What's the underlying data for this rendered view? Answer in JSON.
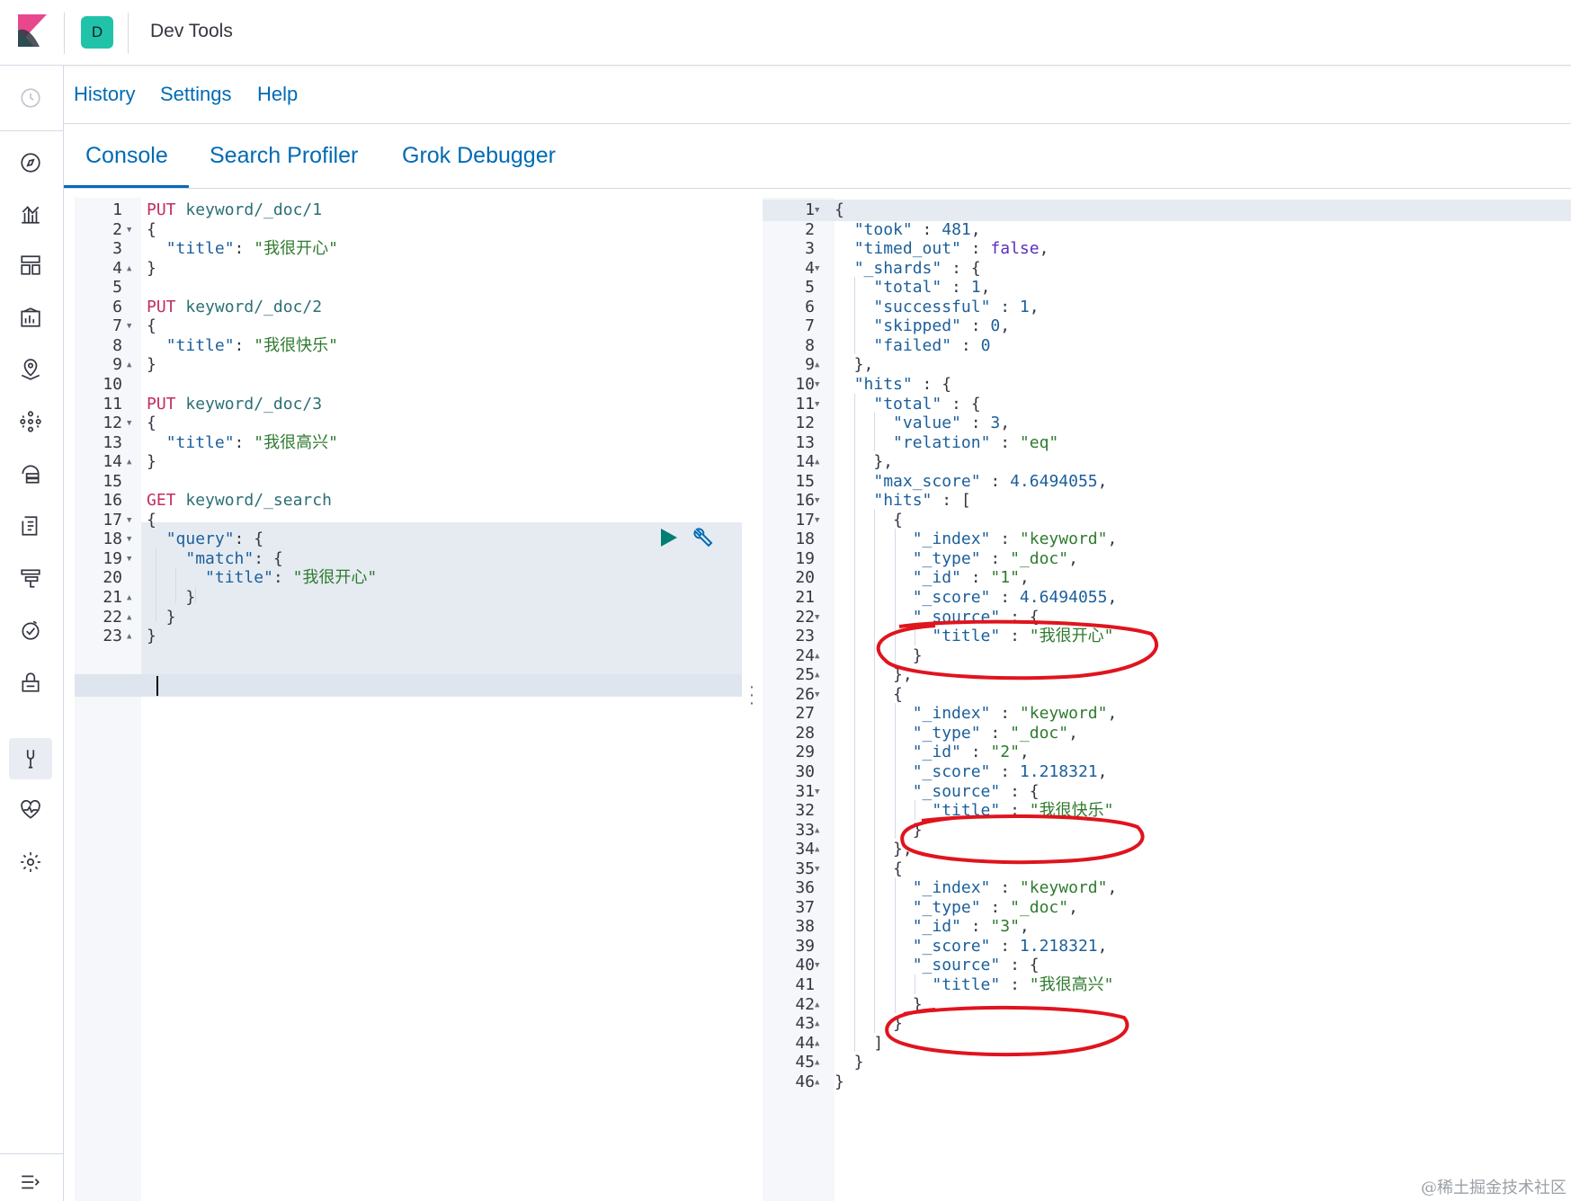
{
  "header": {
    "space_initial": "D",
    "app_title": "Dev Tools"
  },
  "topmenu": {
    "history": "History",
    "settings": "Settings",
    "help": "Help"
  },
  "tabs": [
    {
      "label": "Console"
    },
    {
      "label": "Search Profiler"
    },
    {
      "label": "Grok Debugger"
    }
  ],
  "sidenav_icons": [
    "recently-viewed-icon",
    "discover-icon",
    "visualize-icon",
    "dashboard-icon",
    "canvas-icon",
    "maps-icon",
    "machine-learning-icon",
    "infrastructure-icon",
    "logs-icon",
    "apm-icon",
    "uptime-icon",
    "siem-icon",
    "dev-tools-icon",
    "monitoring-icon",
    "management-icon",
    "collapse-menu-icon"
  ],
  "request_editor": {
    "lines": [
      [
        [
          "m",
          "PUT"
        ],
        [
          "p",
          " "
        ],
        [
          "u",
          "keyword/_doc/1"
        ]
      ],
      [
        [
          "p",
          "{"
        ]
      ],
      [
        [
          "p",
          "  "
        ],
        [
          "k",
          "\"title\""
        ],
        [
          "p",
          ": "
        ],
        [
          "s",
          "\"我很开心\""
        ]
      ],
      [
        [
          "p",
          "}"
        ]
      ],
      [],
      [
        [
          "m",
          "PUT"
        ],
        [
          "p",
          " "
        ],
        [
          "u",
          "keyword/_doc/2"
        ]
      ],
      [
        [
          "p",
          "{"
        ]
      ],
      [
        [
          "p",
          "  "
        ],
        [
          "k",
          "\"title\""
        ],
        [
          "p",
          ": "
        ],
        [
          "s",
          "\"我很快乐\""
        ]
      ],
      [
        [
          "p",
          "}"
        ]
      ],
      [],
      [
        [
          "m",
          "PUT"
        ],
        [
          "p",
          " "
        ],
        [
          "u",
          "keyword/_doc/3"
        ]
      ],
      [
        [
          "p",
          "{"
        ]
      ],
      [
        [
          "p",
          "  "
        ],
        [
          "k",
          "\"title\""
        ],
        [
          "p",
          ": "
        ],
        [
          "s",
          "\"我很高兴\""
        ]
      ],
      [
        [
          "p",
          "}"
        ]
      ],
      [],
      [
        [
          "m",
          "GET"
        ],
        [
          "p",
          " "
        ],
        [
          "u",
          "keyword/_search"
        ]
      ],
      [
        [
          "p",
          "{"
        ]
      ],
      [
        [
          "p",
          "  "
        ],
        [
          "k",
          "\"query\""
        ],
        [
          "p",
          ": {"
        ]
      ],
      [
        [
          "p",
          "    "
        ],
        [
          "k",
          "\"match\""
        ],
        [
          "p",
          ": {"
        ]
      ],
      [
        [
          "p",
          "      "
        ],
        [
          "k",
          "\"title\""
        ],
        [
          "p",
          ": "
        ],
        [
          "s",
          "\"我很开心\""
        ]
      ],
      [
        [
          "p",
          "    }"
        ]
      ],
      [
        [
          "p",
          "  }"
        ]
      ],
      [
        [
          "p",
          "}"
        ]
      ]
    ],
    "fold_markers": {
      "2": "down",
      "4": "up",
      "7": "down",
      "9": "up",
      "12": "down",
      "14": "up",
      "17": "down",
      "18": "down",
      "19": "down",
      "21": "up",
      "22": "up",
      "23": "up"
    }
  },
  "response_output": {
    "lines": [
      [
        [
          "p",
          "{"
        ]
      ],
      [
        [
          "p",
          "  "
        ],
        [
          "k",
          "\"took\""
        ],
        [
          "p",
          " : "
        ],
        [
          "n",
          "481"
        ],
        [
          "p",
          ","
        ]
      ],
      [
        [
          "p",
          "  "
        ],
        [
          "k",
          "\"timed_out\""
        ],
        [
          "p",
          " : "
        ],
        [
          "b",
          "false"
        ],
        [
          "p",
          ","
        ]
      ],
      [
        [
          "p",
          "  "
        ],
        [
          "k",
          "\"_shards\""
        ],
        [
          "p",
          " : {"
        ]
      ],
      [
        [
          "p",
          "    "
        ],
        [
          "k",
          "\"total\""
        ],
        [
          "p",
          " : "
        ],
        [
          "n",
          "1"
        ],
        [
          "p",
          ","
        ]
      ],
      [
        [
          "p",
          "    "
        ],
        [
          "k",
          "\"successful\""
        ],
        [
          "p",
          " : "
        ],
        [
          "n",
          "1"
        ],
        [
          "p",
          ","
        ]
      ],
      [
        [
          "p",
          "    "
        ],
        [
          "k",
          "\"skipped\""
        ],
        [
          "p",
          " : "
        ],
        [
          "n",
          "0"
        ],
        [
          "p",
          ","
        ]
      ],
      [
        [
          "p",
          "    "
        ],
        [
          "k",
          "\"failed\""
        ],
        [
          "p",
          " : "
        ],
        [
          "n",
          "0"
        ]
      ],
      [
        [
          "p",
          "  },"
        ]
      ],
      [
        [
          "p",
          "  "
        ],
        [
          "k",
          "\"hits\""
        ],
        [
          "p",
          " : {"
        ]
      ],
      [
        [
          "p",
          "    "
        ],
        [
          "k",
          "\"total\""
        ],
        [
          "p",
          " : {"
        ]
      ],
      [
        [
          "p",
          "      "
        ],
        [
          "k",
          "\"value\""
        ],
        [
          "p",
          " : "
        ],
        [
          "n",
          "3"
        ],
        [
          "p",
          ","
        ]
      ],
      [
        [
          "p",
          "      "
        ],
        [
          "k",
          "\"relation\""
        ],
        [
          "p",
          " : "
        ],
        [
          "s",
          "\"eq\""
        ]
      ],
      [
        [
          "p",
          "    },"
        ]
      ],
      [
        [
          "p",
          "    "
        ],
        [
          "k",
          "\"max_score\""
        ],
        [
          "p",
          " : "
        ],
        [
          "n",
          "4.6494055"
        ],
        [
          "p",
          ","
        ]
      ],
      [
        [
          "p",
          "    "
        ],
        [
          "k",
          "\"hits\""
        ],
        [
          "p",
          " : ["
        ]
      ],
      [
        [
          "p",
          "      {"
        ]
      ],
      [
        [
          "p",
          "        "
        ],
        [
          "k",
          "\"_index\""
        ],
        [
          "p",
          " : "
        ],
        [
          "s",
          "\"keyword\""
        ],
        [
          "p",
          ","
        ]
      ],
      [
        [
          "p",
          "        "
        ],
        [
          "k",
          "\"_type\""
        ],
        [
          "p",
          " : "
        ],
        [
          "s",
          "\"_doc\""
        ],
        [
          "p",
          ","
        ]
      ],
      [
        [
          "p",
          "        "
        ],
        [
          "k",
          "\"_id\""
        ],
        [
          "p",
          " : "
        ],
        [
          "s",
          "\"1\""
        ],
        [
          "p",
          ","
        ]
      ],
      [
        [
          "p",
          "        "
        ],
        [
          "k",
          "\"_score\""
        ],
        [
          "p",
          " : "
        ],
        [
          "n",
          "4.6494055"
        ],
        [
          "p",
          ","
        ]
      ],
      [
        [
          "p",
          "        "
        ],
        [
          "k",
          "\"_source\""
        ],
        [
          "p",
          " : {"
        ]
      ],
      [
        [
          "p",
          "          "
        ],
        [
          "k",
          "\"title\""
        ],
        [
          "p",
          " : "
        ],
        [
          "s",
          "\"我很开心\""
        ]
      ],
      [
        [
          "p",
          "        }"
        ]
      ],
      [
        [
          "p",
          "      },"
        ]
      ],
      [
        [
          "p",
          "      {"
        ]
      ],
      [
        [
          "p",
          "        "
        ],
        [
          "k",
          "\"_index\""
        ],
        [
          "p",
          " : "
        ],
        [
          "s",
          "\"keyword\""
        ],
        [
          "p",
          ","
        ]
      ],
      [
        [
          "p",
          "        "
        ],
        [
          "k",
          "\"_type\""
        ],
        [
          "p",
          " : "
        ],
        [
          "s",
          "\"_doc\""
        ],
        [
          "p",
          ","
        ]
      ],
      [
        [
          "p",
          "        "
        ],
        [
          "k",
          "\"_id\""
        ],
        [
          "p",
          " : "
        ],
        [
          "s",
          "\"2\""
        ],
        [
          "p",
          ","
        ]
      ],
      [
        [
          "p",
          "        "
        ],
        [
          "k",
          "\"_score\""
        ],
        [
          "p",
          " : "
        ],
        [
          "n",
          "1.218321"
        ],
        [
          "p",
          ","
        ]
      ],
      [
        [
          "p",
          "        "
        ],
        [
          "k",
          "\"_source\""
        ],
        [
          "p",
          " : {"
        ]
      ],
      [
        [
          "p",
          "          "
        ],
        [
          "k",
          "\"title\""
        ],
        [
          "p",
          " : "
        ],
        [
          "s",
          "\"我很快乐\""
        ]
      ],
      [
        [
          "p",
          "        }"
        ]
      ],
      [
        [
          "p",
          "      },"
        ]
      ],
      [
        [
          "p",
          "      {"
        ]
      ],
      [
        [
          "p",
          "        "
        ],
        [
          "k",
          "\"_index\""
        ],
        [
          "p",
          " : "
        ],
        [
          "s",
          "\"keyword\""
        ],
        [
          "p",
          ","
        ]
      ],
      [
        [
          "p",
          "        "
        ],
        [
          "k",
          "\"_type\""
        ],
        [
          "p",
          " : "
        ],
        [
          "s",
          "\"_doc\""
        ],
        [
          "p",
          ","
        ]
      ],
      [
        [
          "p",
          "        "
        ],
        [
          "k",
          "\"_id\""
        ],
        [
          "p",
          " : "
        ],
        [
          "s",
          "\"3\""
        ],
        [
          "p",
          ","
        ]
      ],
      [
        [
          "p",
          "        "
        ],
        [
          "k",
          "\"_score\""
        ],
        [
          "p",
          " : "
        ],
        [
          "n",
          "1.218321"
        ],
        [
          "p",
          ","
        ]
      ],
      [
        [
          "p",
          "        "
        ],
        [
          "k",
          "\"_source\""
        ],
        [
          "p",
          " : {"
        ]
      ],
      [
        [
          "p",
          "          "
        ],
        [
          "k",
          "\"title\""
        ],
        [
          "p",
          " : "
        ],
        [
          "s",
          "\"我很高兴\""
        ]
      ],
      [
        [
          "p",
          "        }"
        ]
      ],
      [
        [
          "p",
          "      }"
        ]
      ],
      [
        [
          "p",
          "    ]"
        ]
      ],
      [
        [
          "p",
          "  }"
        ]
      ],
      [
        [
          "p",
          "}"
        ]
      ]
    ],
    "fold_markers": {
      "1": "down",
      "4": "down",
      "9": "up",
      "10": "down",
      "11": "down",
      "14": "up",
      "16": "down",
      "17": "down",
      "22": "down",
      "24": "up",
      "25": "up",
      "26": "down",
      "31": "down",
      "33": "up",
      "34": "up",
      "35": "down",
      "40": "down",
      "42": "up",
      "43": "up",
      "44": "up",
      "45": "up",
      "46": "up"
    }
  },
  "annotations": {
    "highlight_color": "#e0141e",
    "highlighted_lines": [
      21,
      30,
      39
    ]
  },
  "colors": {
    "accent": "#006bb4",
    "teal": "#20c3a9",
    "method": "#c42d5d"
  },
  "watermark": "@稀土掘金技术社区"
}
